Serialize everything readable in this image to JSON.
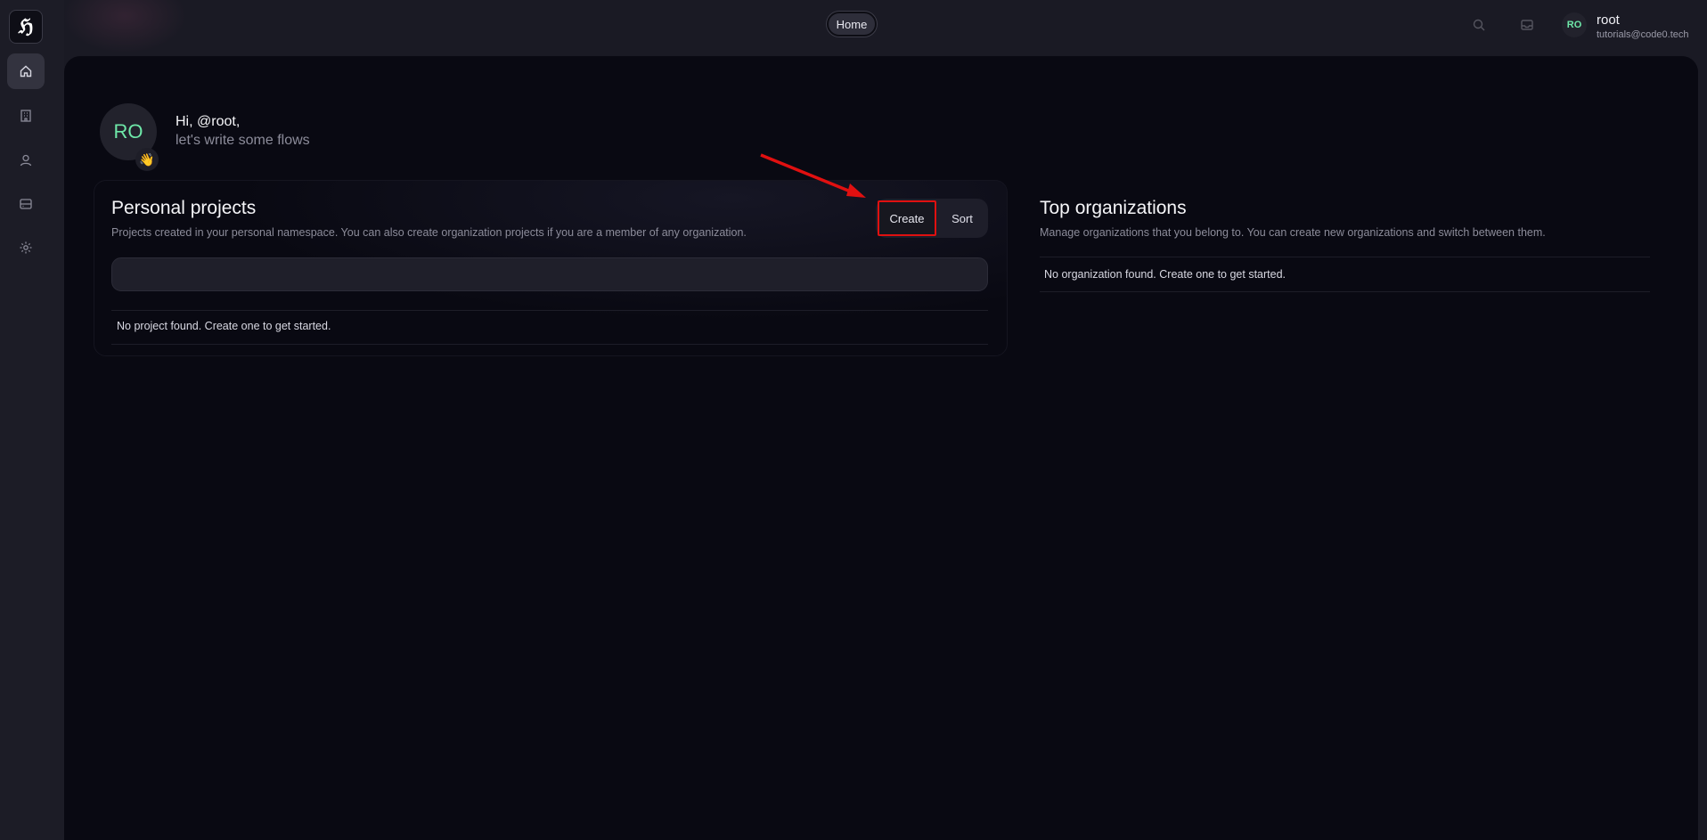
{
  "app": {
    "logo_glyph": "ℌ"
  },
  "sidebar": {
    "items": [
      {
        "name": "home",
        "icon": "home-icon",
        "active": true
      },
      {
        "name": "organizations",
        "icon": "building-icon",
        "active": false
      },
      {
        "name": "profile",
        "icon": "user-icon",
        "active": false
      },
      {
        "name": "storage",
        "icon": "server-icon",
        "active": false
      },
      {
        "name": "settings",
        "icon": "gear-icon",
        "active": false
      }
    ]
  },
  "topbar": {
    "breadcrumb": "Home",
    "icons": [
      "search-icon",
      "inbox-icon"
    ],
    "user": {
      "initials": "RO",
      "name": "root",
      "email": "tutorials@code0.tech"
    }
  },
  "greeting": {
    "avatar_initials": "RO",
    "emoji": "👋",
    "line1": "Hi, @root,",
    "line2": "let's write some flows"
  },
  "personal_projects": {
    "title": "Personal projects",
    "description": "Projects created in your personal namespace. You can also create organization projects if you are a member of any organization.",
    "create_label": "Create",
    "sort_label": "Sort",
    "search_placeholder": "",
    "empty_message": "No project found. Create one to get started."
  },
  "top_organizations": {
    "title": "Top organizations",
    "description": "Manage organizations that you belong to. You can create new organizations and switch between them.",
    "empty_message": "No organization found. Create one to get started."
  },
  "colors": {
    "accent_green": "#6ee7a8",
    "highlight_red": "#e01010",
    "background": "#090912"
  }
}
